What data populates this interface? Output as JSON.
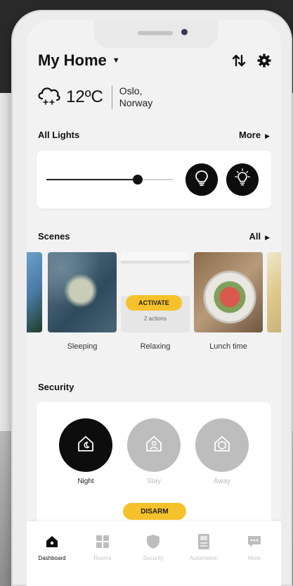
{
  "header": {
    "title": "My Home",
    "dropdown_icon": "caret-down-icon",
    "swap_icon": "swap-arrows-icon",
    "settings_icon": "gear-icon"
  },
  "weather": {
    "icon": "cloud-snow-icon",
    "temperature": "12ºC",
    "location_line1": "Oslo,",
    "location_line2": "Norway"
  },
  "lights": {
    "section_title": "All Lights",
    "more_label": "More",
    "brightness": 0.72,
    "bulb_off_icon": "bulb-icon",
    "bulb_on_icon": "bulb-on-icon"
  },
  "scenes": {
    "section_title": "Scenes",
    "all_label": "All",
    "items": [
      {
        "label": "Sleeping"
      },
      {
        "label": "Relaxing",
        "activate_label": "ACTIVATE",
        "actions_text": "2 actions"
      },
      {
        "label": "Lunch time"
      }
    ]
  },
  "security": {
    "section_title": "Security",
    "modes": [
      {
        "label": "Night",
        "icon": "house-moon-icon",
        "active": true
      },
      {
        "label": "Stay",
        "icon": "house-person-icon",
        "active": false
      },
      {
        "label": "Away",
        "icon": "house-shield-icon",
        "active": false
      }
    ],
    "disarm_label": "DISARM"
  },
  "tabs": [
    {
      "label": "Dashboard",
      "icon": "home-icon",
      "active": true
    },
    {
      "label": "Rooms",
      "icon": "grid-icon",
      "active": false
    },
    {
      "label": "Security",
      "icon": "shield-icon",
      "active": false
    },
    {
      "label": "Automation",
      "icon": "device-icon",
      "active": false
    },
    {
      "label": "More",
      "icon": "chat-icon",
      "active": false
    }
  ],
  "colors": {
    "accent": "#f6c22b",
    "active": "#0d0d0d",
    "inactive": "#bdbdbd"
  }
}
